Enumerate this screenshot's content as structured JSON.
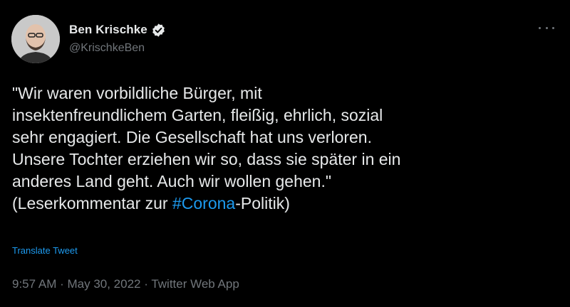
{
  "author": {
    "display_name": "Ben Krischke",
    "handle": "@KrischkeBen",
    "verified": true
  },
  "tweet": {
    "lines": [
      "\"Wir waren vorbildliche Bürger, mit",
      "insektenfreundlichem Garten, fleißig, ehrlich, sozial",
      "sehr engagiert. Die Gesellschaft hat uns verloren.",
      "Unsere Tochter erziehen wir so, dass sie später in ein",
      "anderes Land geht. Auch wir wollen gehen.\""
    ],
    "last_line_prefix": "(Leserkommentar zur ",
    "hashtag": "#Corona",
    "last_line_suffix": "-Politik)"
  },
  "translate_label": "Translate Tweet",
  "meta": {
    "time": "9:57 AM",
    "separator": " · ",
    "date": "May 30, 2022",
    "source": "Twitter Web App"
  },
  "colors": {
    "background": "#000000",
    "text": "#e7e9ea",
    "secondary": "#71767b",
    "accent": "#1d9bf0"
  },
  "icons": {
    "verified": "verified-badge-icon",
    "more": "more-options-icon"
  }
}
